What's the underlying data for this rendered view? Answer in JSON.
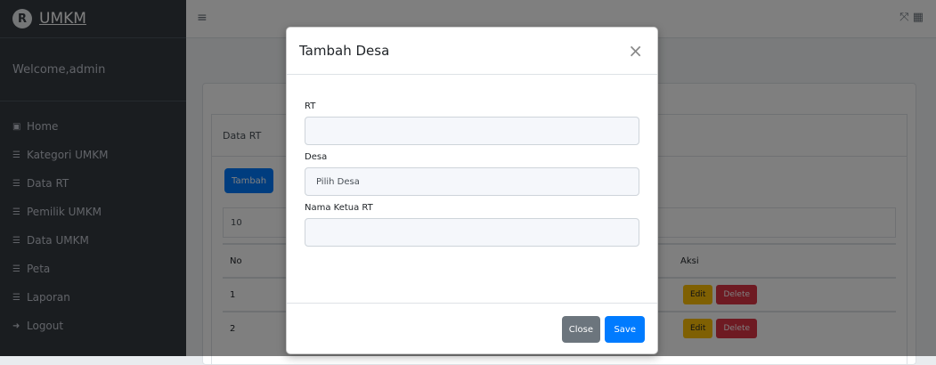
{
  "brand": {
    "logo_letter": "R",
    "name": "UMKM"
  },
  "user_panel": {
    "text": "Welcome,admin"
  },
  "sidebar": {
    "items": [
      {
        "icon": "dashboard-icon",
        "glyph": "▣",
        "label": "Home"
      },
      {
        "icon": "list-icon",
        "glyph": "☰",
        "label": "Kategori UMKM"
      },
      {
        "icon": "list-icon",
        "glyph": "☰",
        "label": "Data RT"
      },
      {
        "icon": "list-icon",
        "glyph": "☰",
        "label": "Pemilik UMKM"
      },
      {
        "icon": "list-icon",
        "glyph": "☰",
        "label": "Data UMKM"
      },
      {
        "icon": "list-icon",
        "glyph": "☰",
        "label": "Peta"
      },
      {
        "icon": "list-icon",
        "glyph": "☰",
        "label": "Laporan"
      },
      {
        "icon": "logout-icon",
        "glyph": "➜",
        "label": "Logout"
      }
    ]
  },
  "topbar": {
    "menu_glyph": "≡",
    "right_glyphs": "⤧ ▦"
  },
  "card": {
    "header": "Data RT",
    "add_button": "Tambah",
    "length_value": "10"
  },
  "table": {
    "headers": {
      "no": "No",
      "aksi": "Aksi"
    },
    "rows": [
      {
        "no": "1",
        "edit": "Edit",
        "delete": "Delete"
      },
      {
        "no": "2",
        "edit": "Edit",
        "delete": "Delete"
      }
    ]
  },
  "modal": {
    "title": "Tambah Desa",
    "close_glyph": "×",
    "fields": {
      "rt_label": "RT",
      "rt_value": "",
      "desa_label": "Desa",
      "desa_value": "Pilih Desa",
      "ketua_label": "Nama Ketua RT",
      "ketua_value": ""
    },
    "close_button": "Close",
    "save_button": "Save"
  }
}
